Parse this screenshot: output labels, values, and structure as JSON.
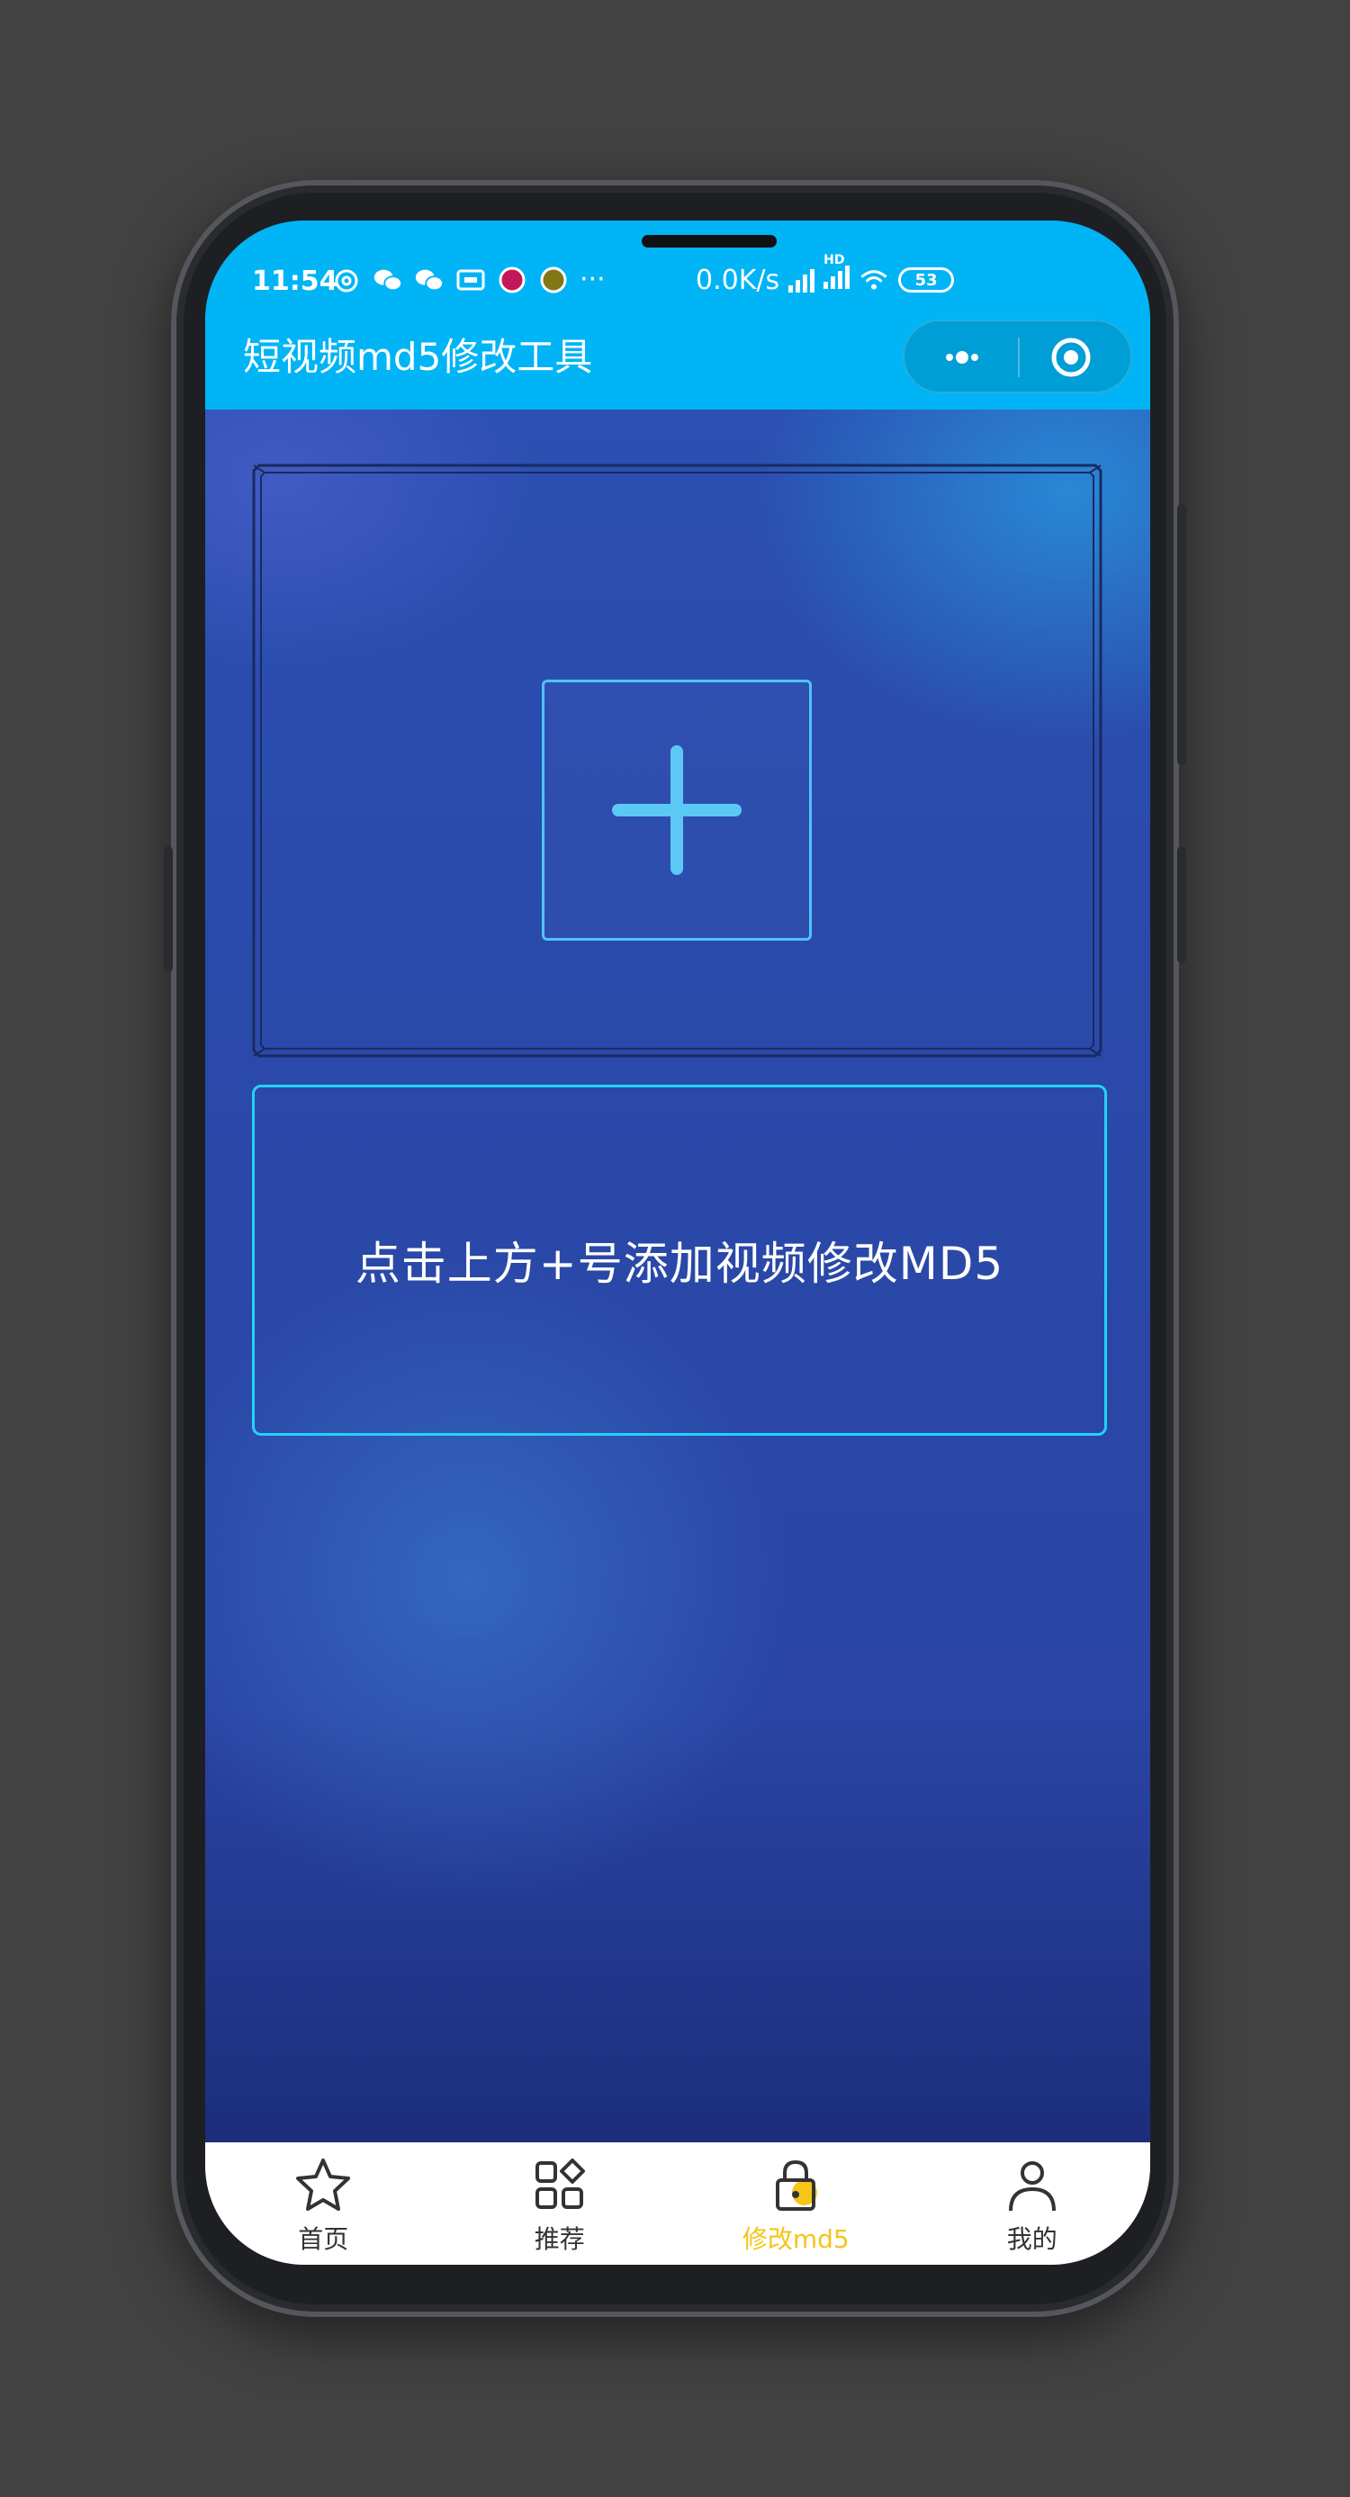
{
  "status_bar": {
    "time": "11:54",
    "more": "···",
    "net_speed": "0.0K/s",
    "network_label": "HD",
    "battery": "53"
  },
  "nav": {
    "title": "短视频md5修改工具"
  },
  "upload": {
    "add_icon": "plus-icon"
  },
  "hint": {
    "text": "点击上方+号添加视频修改MD5"
  },
  "tabbar": {
    "items": [
      {
        "label": "首页",
        "icon": "star-icon",
        "active": false
      },
      {
        "label": "推荐",
        "icon": "grid-icon",
        "active": false
      },
      {
        "label": "修改md5",
        "icon": "lock-icon",
        "active": true
      },
      {
        "label": "我的",
        "icon": "user-icon",
        "active": false
      }
    ]
  },
  "colors": {
    "header": "#00b4f5",
    "accent_cyan": "#22d3f6",
    "active_tab": "#f5c518",
    "background": "#2b46a5"
  }
}
